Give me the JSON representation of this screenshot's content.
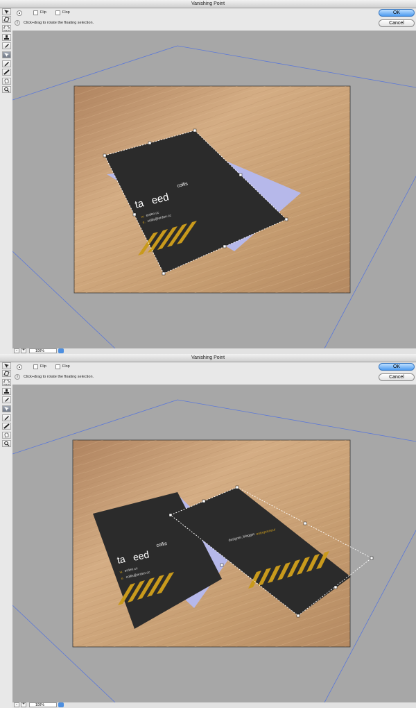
{
  "windows": [
    {
      "title": "Vanishing Point",
      "options": {
        "flip_label": "Flip",
        "flop_label": "Flop"
      },
      "hint": "Click+drag to rotate the floating selection.",
      "ok_label": "OK",
      "cancel_label": "Cancel",
      "zoom": "100%",
      "card_front": {
        "brand_a": "ta",
        "brand_b": "eed",
        "name": "collis",
        "web_prefix": "w.",
        "web": "erden.cc",
        "email_prefix": "e.",
        "email": "collis@erden.cc"
      }
    },
    {
      "title": "Vanishing Point",
      "options": {
        "flip_label": "Flip",
        "flop_label": "Flop"
      },
      "hint": "Click+drag to rotate the floating selection.",
      "ok_label": "OK",
      "cancel_label": "Cancel",
      "zoom": "100%",
      "card_front": {
        "brand_a": "ta",
        "brand_b": "eed",
        "name": "collis",
        "web_prefix": "w.",
        "web": "erden.cc",
        "email_prefix": "e.",
        "email": "collis@erden.cc"
      },
      "card_back": {
        "tagline_a": "designer, blogger,",
        "tagline_b": "entrepreneur"
      }
    }
  ],
  "icons": [
    "edit-plane-icon",
    "create-plane-icon",
    "marquee-icon",
    "stamp-icon",
    "brush-icon",
    "transform-icon",
    "eyedropper-icon",
    "measure-icon",
    "hand-icon",
    "zoom-icon"
  ],
  "colors": {
    "accent": "#4d9bf0",
    "plane_line": "#5b78d8",
    "card": "#2b2b2b",
    "stripe": "#c99a1c",
    "paper": "#b6b8ea",
    "wood": "#c9a27a"
  }
}
